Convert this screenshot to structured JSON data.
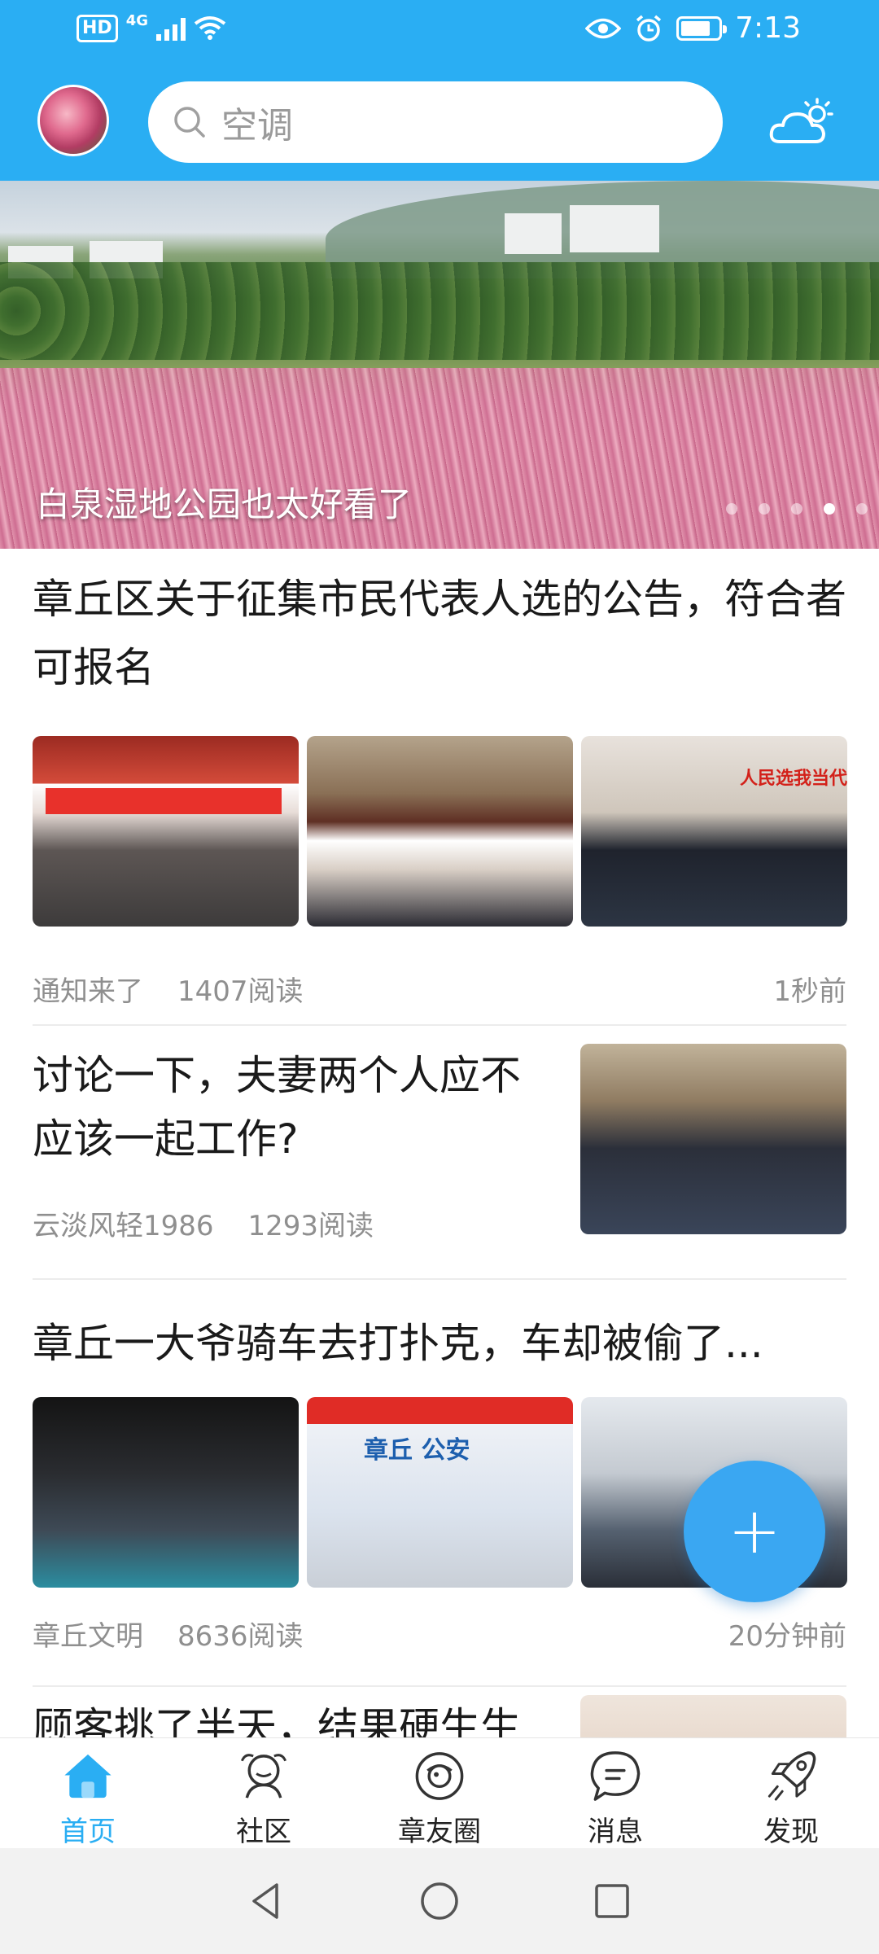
{
  "status_bar": {
    "hd": "HD",
    "network": "4G",
    "time": "7:13"
  },
  "header": {
    "search_placeholder": "空调",
    "accent_color": "#2aaef3"
  },
  "banner": {
    "caption": "白泉湿地公园也太好看了",
    "active_dot_index": 3
  },
  "feed": [
    {
      "title": "章丘区关于征集市民代表人选的公告，符合者可报名",
      "source": "通知来了",
      "reads": "1407阅读",
      "time": "1秒前"
    },
    {
      "title": "讨论一下，夫妻两个人应不应该一起工作?",
      "source": "云淡风轻1986",
      "reads": "1293阅读",
      "time": ""
    },
    {
      "title": "章丘一大爷骑车去打扑克，车却被偷了...",
      "source": "章丘文明",
      "reads": "8636阅读",
      "time": "20分钟前"
    },
    {
      "title": "顾客挑了半天，结果硬生生",
      "source": "",
      "reads": "",
      "time": ""
    }
  ],
  "fab": {
    "label": "+"
  },
  "bottom_nav": [
    {
      "label": "首页",
      "icon": "home-icon",
      "active": true
    },
    {
      "label": "社区",
      "icon": "community-icon",
      "active": false
    },
    {
      "label": "章友圈",
      "icon": "circle-icon",
      "active": false
    },
    {
      "label": "消息",
      "icon": "message-icon",
      "active": false
    },
    {
      "label": "发现",
      "icon": "rocket-icon",
      "active": false
    }
  ]
}
